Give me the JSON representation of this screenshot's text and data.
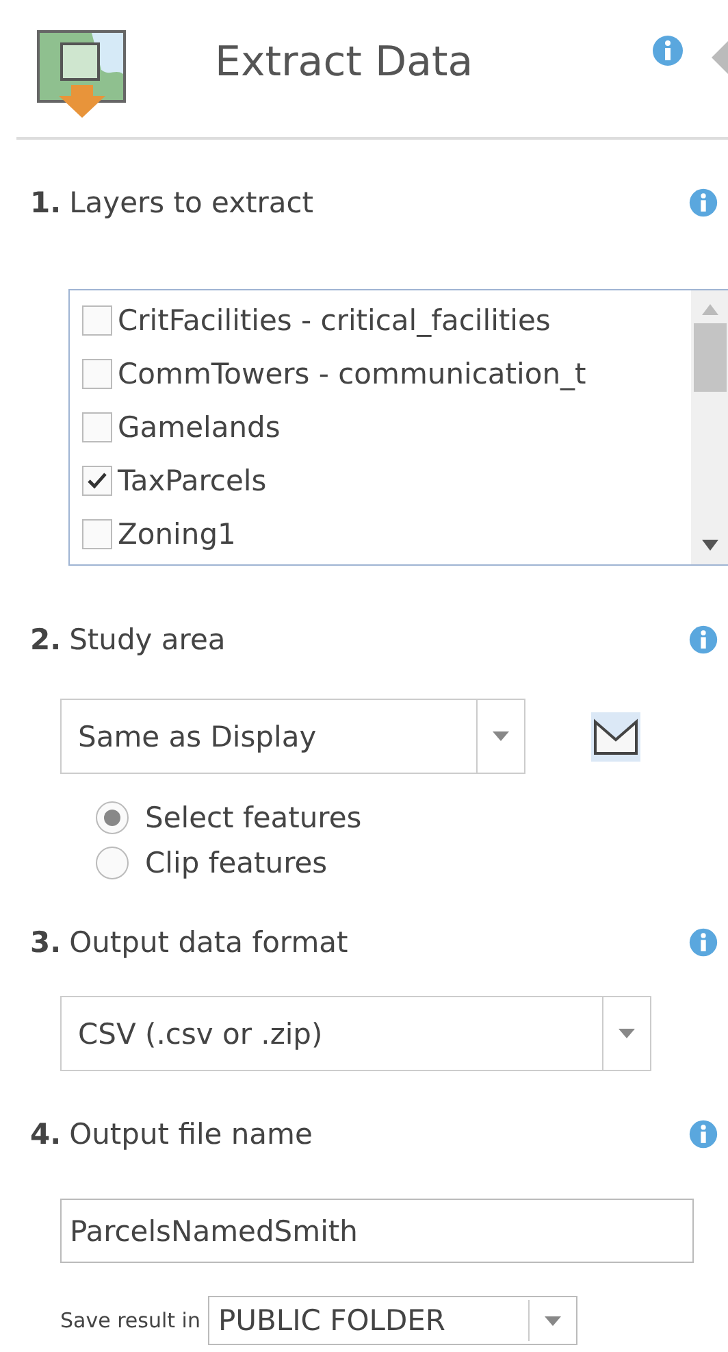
{
  "panel": {
    "title": "Extract Data"
  },
  "steps": [
    {
      "number": "1.",
      "label": "Layers to extract",
      "kind": "layers",
      "layers": [
        {
          "label": "CritFacilities - critical_facilities",
          "checked": false
        },
        {
          "label": "CommTowers - communication_t",
          "checked": false
        },
        {
          "label": "Gamelands",
          "checked": false
        },
        {
          "label": "TaxParcels",
          "checked": true
        },
        {
          "label": "Zoning1",
          "checked": false
        }
      ]
    },
    {
      "number": "2.",
      "label": "Study area",
      "kind": "area",
      "select": {
        "value": "Same as Display"
      },
      "options": [
        {
          "label": "Select features",
          "selected": true
        },
        {
          "label": "Clip features",
          "selected": false
        }
      ]
    },
    {
      "number": "3.",
      "label": "Output data format",
      "kind": "format",
      "select": {
        "value": "CSV (.csv or .zip)"
      }
    },
    {
      "number": "4.",
      "label": "Output file name",
      "kind": "filename",
      "input": {
        "value": "ParcelsNamedSmith"
      },
      "save": {
        "label": "Save result in",
        "value": "PUBLIC FOLDER"
      }
    }
  ]
}
